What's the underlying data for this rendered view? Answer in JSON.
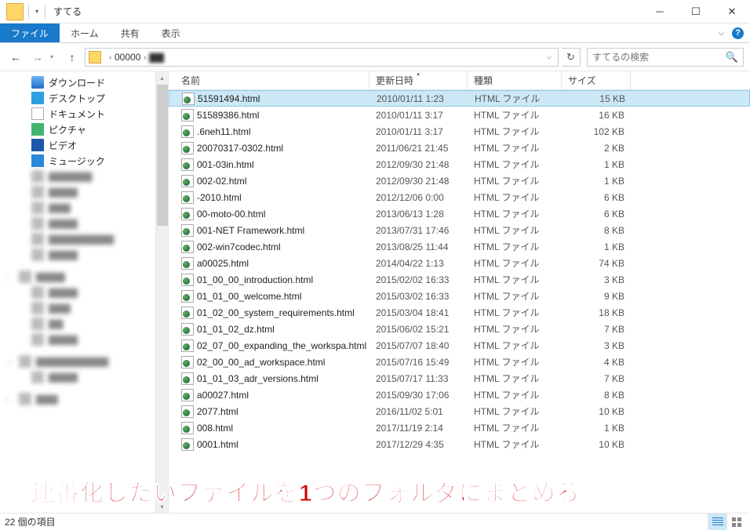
{
  "window": {
    "title": "すてる"
  },
  "ribbon": {
    "file": "ファイル",
    "home": "ホーム",
    "share": "共有",
    "view": "表示"
  },
  "nav": {
    "address_seg1": "00000",
    "search_placeholder": "すてるの検索"
  },
  "tree": {
    "downloads": "ダウンロード",
    "desktop": "デスクトップ",
    "documents": "ドキュメント",
    "pictures": "ピクチャ",
    "videos": "ビデオ",
    "music": "ミュージック"
  },
  "columns": {
    "name": "名前",
    "date": "更新日時",
    "type": "種類",
    "size": "サイズ"
  },
  "filetype": "HTML ファイル",
  "files": [
    {
      "name": "51591494.html",
      "date": "2010/01/11 1:23",
      "size": "15 KB"
    },
    {
      "name": "51589386.html",
      "date": "2010/01/11 3:17",
      "size": "16 KB"
    },
    {
      "name": ".6neh11.html",
      "date": "2010/01/11 3:17",
      "size": "102 KB"
    },
    {
      "name": "20070317-0302.html",
      "date": "2011/06/21 21:45",
      "size": "2 KB"
    },
    {
      "name": "001-03in.html",
      "date": "2012/09/30 21:48",
      "size": "1 KB"
    },
    {
      "name": "002-02.html",
      "date": "2012/09/30 21:48",
      "size": "1 KB"
    },
    {
      "name": "-2010.html",
      "date": "2012/12/06 0:00",
      "size": "6 KB"
    },
    {
      "name": "00-moto-00.html",
      "date": "2013/06/13 1:28",
      "size": "6 KB"
    },
    {
      "name": "001-NET Framework.html",
      "date": "2013/07/31 17:46",
      "size": "8 KB"
    },
    {
      "name": "002-win7codec.html",
      "date": "2013/08/25 11:44",
      "size": "1 KB"
    },
    {
      "name": "a00025.html",
      "date": "2014/04/22 1:13",
      "size": "74 KB"
    },
    {
      "name": "01_00_00_introduction.html",
      "date": "2015/02/02 16:33",
      "size": "3 KB"
    },
    {
      "name": "01_01_00_welcome.html",
      "date": "2015/03/02 16:33",
      "size": "9 KB"
    },
    {
      "name": "01_02_00_system_requirements.html",
      "date": "2015/03/04 18:41",
      "size": "18 KB"
    },
    {
      "name": "01_01_02_dz.html",
      "date": "2015/06/02 15:21",
      "size": "7 KB"
    },
    {
      "name": "02_07_00_expanding_the_workspa.html",
      "date": "2015/07/07 18:40",
      "size": "3 KB"
    },
    {
      "name": "02_00_00_ad_workspace.html",
      "date": "2015/07/16 15:49",
      "size": "4 KB"
    },
    {
      "name": "01_01_03_adr_versions.html",
      "date": "2015/07/17 11:33",
      "size": "7 KB"
    },
    {
      "name": "a00027.html",
      "date": "2015/09/30 17:06",
      "size": "8 KB"
    },
    {
      "name": "2077.html",
      "date": "2016/11/02 5:01",
      "size": "10 KB"
    },
    {
      "name": "008.html",
      "date": "2017/11/19 2:14",
      "size": "1 KB"
    },
    {
      "name": "0001.html",
      "date": "2017/12/29 4:35",
      "size": "10 KB"
    }
  ],
  "status": {
    "count": "22 個の項目"
  },
  "annotation": "連番化したいファイルを1つのフォルダにまとめる"
}
